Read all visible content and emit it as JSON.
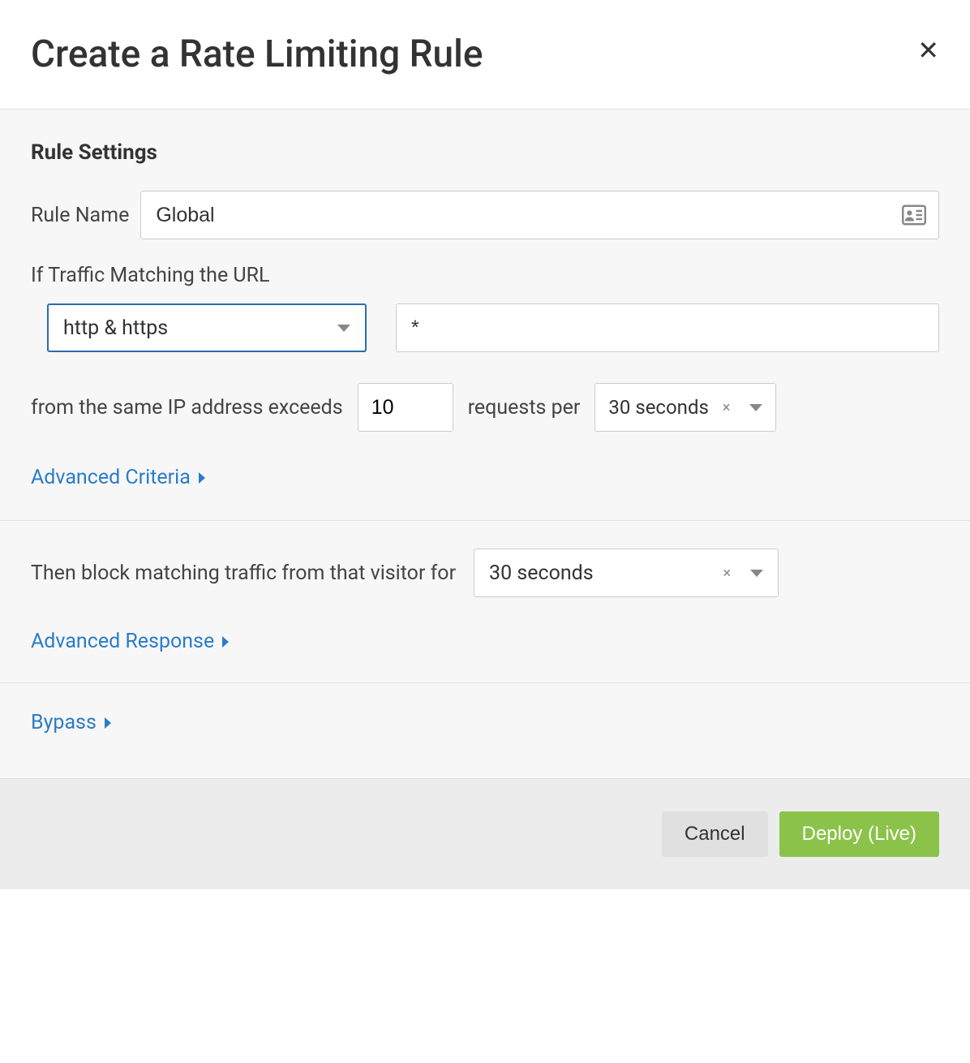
{
  "header": {
    "title": "Create a Rate Limiting Rule",
    "close_label": "✕"
  },
  "settings": {
    "section_title": "Rule Settings",
    "rule_name_label": "Rule Name",
    "rule_name_value": "Global",
    "traffic_label": "If Traffic Matching the URL",
    "scheme_value": "http & https",
    "url_pattern_value": "*",
    "ip_exceeds_label": "from the same IP address exceeds",
    "threshold_value": "10",
    "requests_per_label": "requests per",
    "period_value": "30 seconds",
    "advanced_criteria_label": "Advanced Criteria"
  },
  "block": {
    "label_prefix": "Then block matching traffic from that visitor for",
    "duration_value": "30 seconds",
    "advanced_response_label": "Advanced Response"
  },
  "bypass": {
    "label": "Bypass"
  },
  "footer": {
    "cancel_label": "Cancel",
    "deploy_label": "Deploy (Live)"
  }
}
